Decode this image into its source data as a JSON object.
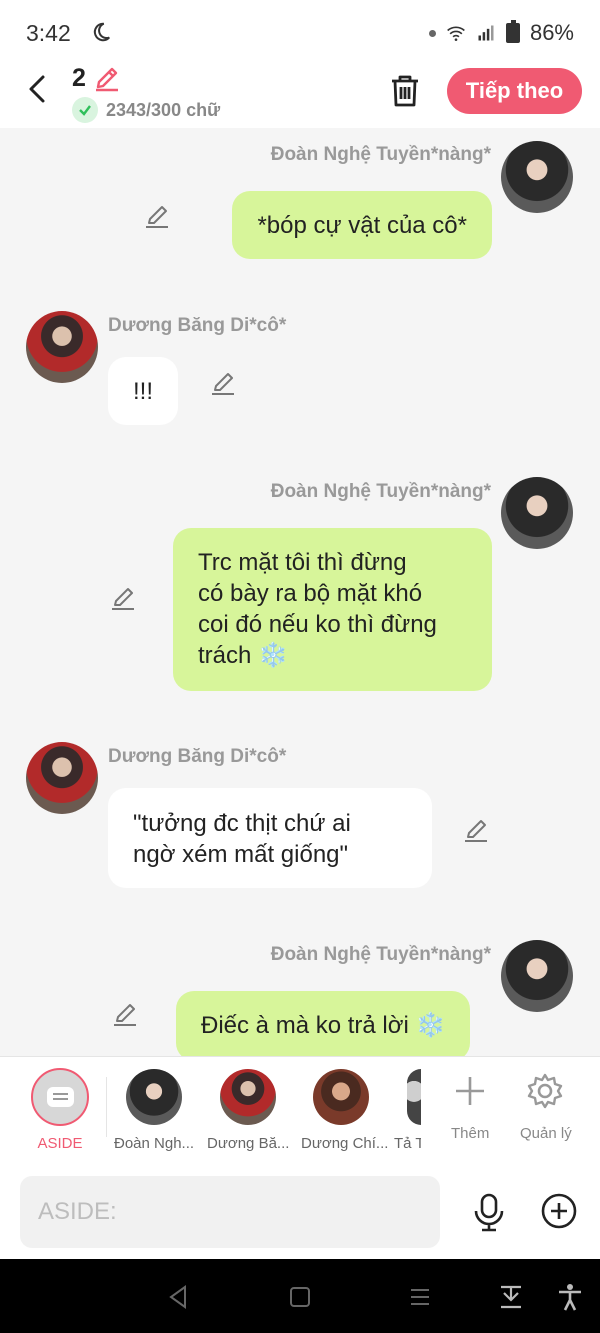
{
  "status": {
    "time": "3:42",
    "battery": "86%"
  },
  "header": {
    "count": "2",
    "word_count": "2343/300 chữ",
    "next_label": "Tiếp theo"
  },
  "messages": [
    {
      "sender": "Đoàn Nghệ Tuyền*nàng*",
      "text": "*bóp cự vật của cô*"
    },
    {
      "sender": "Dương Băng Di*cô*",
      "text": "!!!"
    },
    {
      "sender": "Đoàn Nghệ Tuyền*nàng*",
      "lines": [
        "Trc mặt tôi thì đừng",
        "có bày ra bộ mặt khó",
        "coi đó nếu ko thì đừng",
        "trách ❄️"
      ]
    },
    {
      "sender": "Dương Băng Di*cô*",
      "lines": [
        "\"tưởng đc thịt chứ ai",
        "ngờ xém mất giống\""
      ]
    },
    {
      "sender": "Đoàn Nghệ Tuyền*nàng*",
      "text": "Điếc à mà ko trả lời ❄️"
    }
  ],
  "characters": {
    "aside_label": "ASIDE",
    "items": [
      {
        "label": "Đoàn Ngh..."
      },
      {
        "label": "Dương Bă..."
      },
      {
        "label": "Dương Chí..."
      },
      {
        "label": "Tả T"
      }
    ],
    "add_label": "Thêm",
    "manage_label": "Quản lý"
  },
  "input": {
    "placeholder": "ASIDE:"
  },
  "colors": {
    "accent": "#f05a72",
    "bubble_green": "#d7f59a",
    "bubble_white": "#ffffff"
  }
}
